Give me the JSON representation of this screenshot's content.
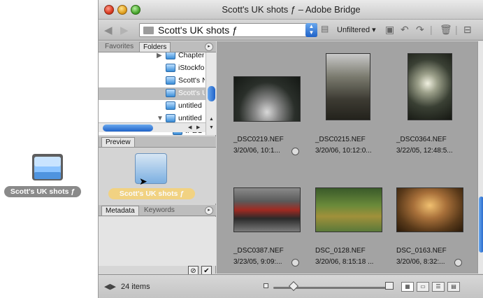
{
  "desktop": {
    "folder_label": "Scott's UK shots ƒ"
  },
  "window": {
    "title": "Scott's UK shots ƒ – Adobe Bridge"
  },
  "toolbar": {
    "path": "Scott's UK shots ƒ",
    "filter": "Unfiltered"
  },
  "left_panel": {
    "tabs": [
      "Favorites",
      "Folders"
    ],
    "folders": [
      {
        "label": "Chapter",
        "expanded": true
      },
      {
        "label": "iStockfo"
      },
      {
        "label": "Scott's N"
      },
      {
        "label": "Scott's U",
        "selected": true
      },
      {
        "label": "untitled"
      },
      {
        "label": "untitled",
        "expanded": true
      },
      {
        "label": "IPEG"
      }
    ],
    "preview_tab": "Preview",
    "preview_label": "Scott's UK shots ƒ",
    "meta_tabs": [
      "Metadata",
      "Keywords"
    ]
  },
  "content": {
    "items": [
      {
        "name": "_DSC0219.NEF",
        "date": "3/20/06, 10:1..."
      },
      {
        "name": "_DSC0215.NEF",
        "date": "3/20/06, 10:12:0..."
      },
      {
        "name": "_DSC0364.NEF",
        "date": "3/22/05, 12:48:5..."
      },
      {
        "name": "_DSC0387.NEF",
        "date": "3/23/05, 9:09:..."
      },
      {
        "name": "DSC_0128.NEF",
        "date": "3/20/06, 8:15:18 ..."
      },
      {
        "name": "DSC_0163.NEF",
        "date": "3/20/06, 8:32:..."
      }
    ]
  },
  "status": {
    "count": "24 items"
  },
  "colors": {
    "content_bg": "#a3a3a3",
    "accent": "#1f62c8"
  }
}
